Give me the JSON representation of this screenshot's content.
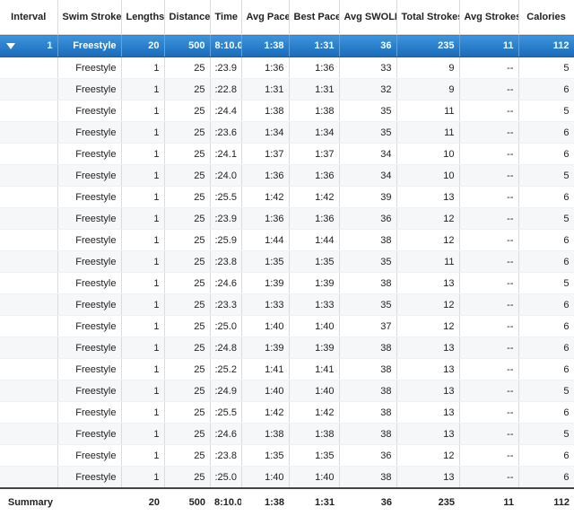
{
  "columns": [
    "Interval",
    "Swim Stroke",
    "Lengths",
    "Distance",
    "Time",
    "Avg Pace",
    "Best Pace",
    "Avg SWOLF",
    "Total Strokes",
    "Avg Strokes",
    "Calories"
  ],
  "interval": {
    "number": "1",
    "stroke": "Freestyle",
    "lengths": "20",
    "distance": "500",
    "time": "8:10.0",
    "avg_pace": "1:38",
    "best_pace": "1:31",
    "swolf": "36",
    "total_strokes": "235",
    "avg_strokes": "11",
    "calories": "112"
  },
  "laps": [
    {
      "stroke": "Freestyle",
      "lengths": "1",
      "distance": "25",
      "time": ":23.9",
      "avg_pace": "1:36",
      "best_pace": "1:36",
      "swolf": "33",
      "total_strokes": "9",
      "avg_strokes": "--",
      "calories": "5"
    },
    {
      "stroke": "Freestyle",
      "lengths": "1",
      "distance": "25",
      "time": ":22.8",
      "avg_pace": "1:31",
      "best_pace": "1:31",
      "swolf": "32",
      "total_strokes": "9",
      "avg_strokes": "--",
      "calories": "6"
    },
    {
      "stroke": "Freestyle",
      "lengths": "1",
      "distance": "25",
      "time": ":24.4",
      "avg_pace": "1:38",
      "best_pace": "1:38",
      "swolf": "35",
      "total_strokes": "11",
      "avg_strokes": "--",
      "calories": "5"
    },
    {
      "stroke": "Freestyle",
      "lengths": "1",
      "distance": "25",
      "time": ":23.6",
      "avg_pace": "1:34",
      "best_pace": "1:34",
      "swolf": "35",
      "total_strokes": "11",
      "avg_strokes": "--",
      "calories": "6"
    },
    {
      "stroke": "Freestyle",
      "lengths": "1",
      "distance": "25",
      "time": ":24.1",
      "avg_pace": "1:37",
      "best_pace": "1:37",
      "swolf": "34",
      "total_strokes": "10",
      "avg_strokes": "--",
      "calories": "6"
    },
    {
      "stroke": "Freestyle",
      "lengths": "1",
      "distance": "25",
      "time": ":24.0",
      "avg_pace": "1:36",
      "best_pace": "1:36",
      "swolf": "34",
      "total_strokes": "10",
      "avg_strokes": "--",
      "calories": "5"
    },
    {
      "stroke": "Freestyle",
      "lengths": "1",
      "distance": "25",
      "time": ":25.5",
      "avg_pace": "1:42",
      "best_pace": "1:42",
      "swolf": "39",
      "total_strokes": "13",
      "avg_strokes": "--",
      "calories": "6"
    },
    {
      "stroke": "Freestyle",
      "lengths": "1",
      "distance": "25",
      "time": ":23.9",
      "avg_pace": "1:36",
      "best_pace": "1:36",
      "swolf": "36",
      "total_strokes": "12",
      "avg_strokes": "--",
      "calories": "5"
    },
    {
      "stroke": "Freestyle",
      "lengths": "1",
      "distance": "25",
      "time": ":25.9",
      "avg_pace": "1:44",
      "best_pace": "1:44",
      "swolf": "38",
      "total_strokes": "12",
      "avg_strokes": "--",
      "calories": "6"
    },
    {
      "stroke": "Freestyle",
      "lengths": "1",
      "distance": "25",
      "time": ":23.8",
      "avg_pace": "1:35",
      "best_pace": "1:35",
      "swolf": "35",
      "total_strokes": "11",
      "avg_strokes": "--",
      "calories": "6"
    },
    {
      "stroke": "Freestyle",
      "lengths": "1",
      "distance": "25",
      "time": ":24.6",
      "avg_pace": "1:39",
      "best_pace": "1:39",
      "swolf": "38",
      "total_strokes": "13",
      "avg_strokes": "--",
      "calories": "5"
    },
    {
      "stroke": "Freestyle",
      "lengths": "1",
      "distance": "25",
      "time": ":23.3",
      "avg_pace": "1:33",
      "best_pace": "1:33",
      "swolf": "35",
      "total_strokes": "12",
      "avg_strokes": "--",
      "calories": "6"
    },
    {
      "stroke": "Freestyle",
      "lengths": "1",
      "distance": "25",
      "time": ":25.0",
      "avg_pace": "1:40",
      "best_pace": "1:40",
      "swolf": "37",
      "total_strokes": "12",
      "avg_strokes": "--",
      "calories": "6"
    },
    {
      "stroke": "Freestyle",
      "lengths": "1",
      "distance": "25",
      "time": ":24.8",
      "avg_pace": "1:39",
      "best_pace": "1:39",
      "swolf": "38",
      "total_strokes": "13",
      "avg_strokes": "--",
      "calories": "6"
    },
    {
      "stroke": "Freestyle",
      "lengths": "1",
      "distance": "25",
      "time": ":25.2",
      "avg_pace": "1:41",
      "best_pace": "1:41",
      "swolf": "38",
      "total_strokes": "13",
      "avg_strokes": "--",
      "calories": "6"
    },
    {
      "stroke": "Freestyle",
      "lengths": "1",
      "distance": "25",
      "time": ":24.9",
      "avg_pace": "1:40",
      "best_pace": "1:40",
      "swolf": "38",
      "total_strokes": "13",
      "avg_strokes": "--",
      "calories": "5"
    },
    {
      "stroke": "Freestyle",
      "lengths": "1",
      "distance": "25",
      "time": ":25.5",
      "avg_pace": "1:42",
      "best_pace": "1:42",
      "swolf": "38",
      "total_strokes": "13",
      "avg_strokes": "--",
      "calories": "6"
    },
    {
      "stroke": "Freestyle",
      "lengths": "1",
      "distance": "25",
      "time": ":24.6",
      "avg_pace": "1:38",
      "best_pace": "1:38",
      "swolf": "38",
      "total_strokes": "13",
      "avg_strokes": "--",
      "calories": "5"
    },
    {
      "stroke": "Freestyle",
      "lengths": "1",
      "distance": "25",
      "time": ":23.8",
      "avg_pace": "1:35",
      "best_pace": "1:35",
      "swolf": "36",
      "total_strokes": "12",
      "avg_strokes": "--",
      "calories": "6"
    },
    {
      "stroke": "Freestyle",
      "lengths": "1",
      "distance": "25",
      "time": ":25.0",
      "avg_pace": "1:40",
      "best_pace": "1:40",
      "swolf": "38",
      "total_strokes": "13",
      "avg_strokes": "--",
      "calories": "6"
    }
  ],
  "summary": {
    "label": "Summary",
    "lengths": "20",
    "distance": "500",
    "time": "8:10.0",
    "avg_pace": "1:38",
    "best_pace": "1:31",
    "swolf": "36",
    "total_strokes": "235",
    "avg_strokes": "11",
    "calories": "112"
  },
  "colors": {
    "selected_top": "#3d95de",
    "selected_bottom": "#1a6ab8",
    "stripe": "#f6f7f8"
  },
  "icons": {
    "expand": "triangle-down-icon"
  }
}
